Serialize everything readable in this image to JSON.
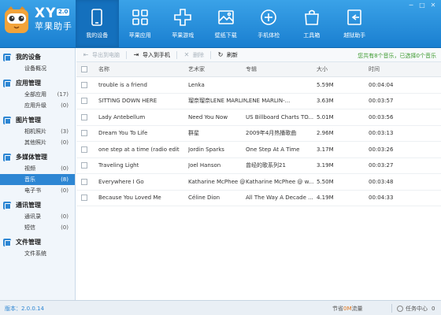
{
  "brand": {
    "name": "XY",
    "version": "2.0",
    "subtitle": "苹果助手"
  },
  "window_controls": [
    "─",
    "□",
    "✕"
  ],
  "nav": [
    {
      "label": "我的设备",
      "icon": "device-icon",
      "active": true
    },
    {
      "label": "苹果应用",
      "icon": "apps-icon"
    },
    {
      "label": "苹果游戏",
      "icon": "games-icon"
    },
    {
      "label": "壁纸下载",
      "icon": "wallpaper-icon"
    },
    {
      "label": "手机体检",
      "icon": "checkup-icon"
    },
    {
      "label": "工具箱",
      "icon": "toolbox-icon"
    },
    {
      "label": "越狱助手",
      "icon": "jailbreak-icon"
    }
  ],
  "sidebar": [
    {
      "title": "我的设备",
      "items": [
        {
          "label": "设备概况",
          "count": ""
        }
      ]
    },
    {
      "title": "应用管理",
      "items": [
        {
          "label": "全部应用",
          "count": "(17)"
        },
        {
          "label": "应用升级",
          "count": "(0)"
        }
      ]
    },
    {
      "title": "图片管理",
      "items": [
        {
          "label": "相机照片",
          "count": "(3)"
        },
        {
          "label": "其他照片",
          "count": "(0)"
        }
      ]
    },
    {
      "title": "多媒体管理",
      "items": [
        {
          "label": "视频",
          "count": "(0)"
        },
        {
          "label": "音乐",
          "count": "(8)",
          "active": true
        },
        {
          "label": "电子书",
          "count": "(0)"
        }
      ]
    },
    {
      "title": "通讯管理",
      "items": [
        {
          "label": "通讯录",
          "count": "(0)"
        },
        {
          "label": "短信",
          "count": "(0)"
        }
      ]
    },
    {
      "title": "文件管理",
      "items": [
        {
          "label": "文件系统",
          "count": ""
        }
      ]
    }
  ],
  "toolbar": {
    "export": "导出到电脑",
    "import": "导入到手机",
    "delete": "删除",
    "refresh": "刷新",
    "status": "您共有8个音乐，已选择0个音乐"
  },
  "table": {
    "headers": {
      "name": "名称",
      "artist": "艺术家",
      "album": "专辑",
      "size": "大小",
      "time": "时间"
    },
    "rows": [
      {
        "name": "trouble is a friend",
        "artist": "Lenka",
        "album": "",
        "size": "5.59M",
        "time": "00:04:04"
      },
      {
        "name": "SITTING DOWN HERE",
        "artist": "瑠奈瑠奈LENE MARLIN",
        "album": "LENE MARLIN-...",
        "size": "3.63M",
        "time": "00:03:57"
      },
      {
        "name": "Lady Antebellum",
        "artist": "Need You Now",
        "album": "US Billboard Charts TO...",
        "size": "5.01M",
        "time": "00:03:56"
      },
      {
        "name": "Dream You To Life",
        "artist": "群星",
        "album": "2009年4月热播歌曲",
        "size": "2.96M",
        "time": "00:03:13"
      },
      {
        "name": "one step at a time (radio edit",
        "artist": "Jordin Sparks",
        "album": "One Step At A Time",
        "size": "3.17M",
        "time": "00:03:26"
      },
      {
        "name": "Traveling Light",
        "artist": "Joel Hanson",
        "album": "曾经的歌系列21",
        "size": "3.19M",
        "time": "00:03:27"
      },
      {
        "name": "Everywhere I Go",
        "artist": "Katharine McPhee @ ...",
        "album": "Katharine McPhee @ w...",
        "size": "5.50M",
        "time": "00:03:48"
      },
      {
        "name": "Because You Loved Me",
        "artist": "Céline Dion",
        "album": "All The Way A Decade ...",
        "size": "4.19M",
        "time": "00:04:33"
      }
    ]
  },
  "statusbar": {
    "version": "版本：2.0.0.14",
    "traffic_prefix": "节省",
    "traffic_value": "0M",
    "traffic_suffix": "流量",
    "task_center": "任务中心",
    "task_count": "0"
  },
  "colors": {
    "accent": "#1a7fd0",
    "selected": "#2d86d3",
    "status_green": "#3d9a2f"
  }
}
